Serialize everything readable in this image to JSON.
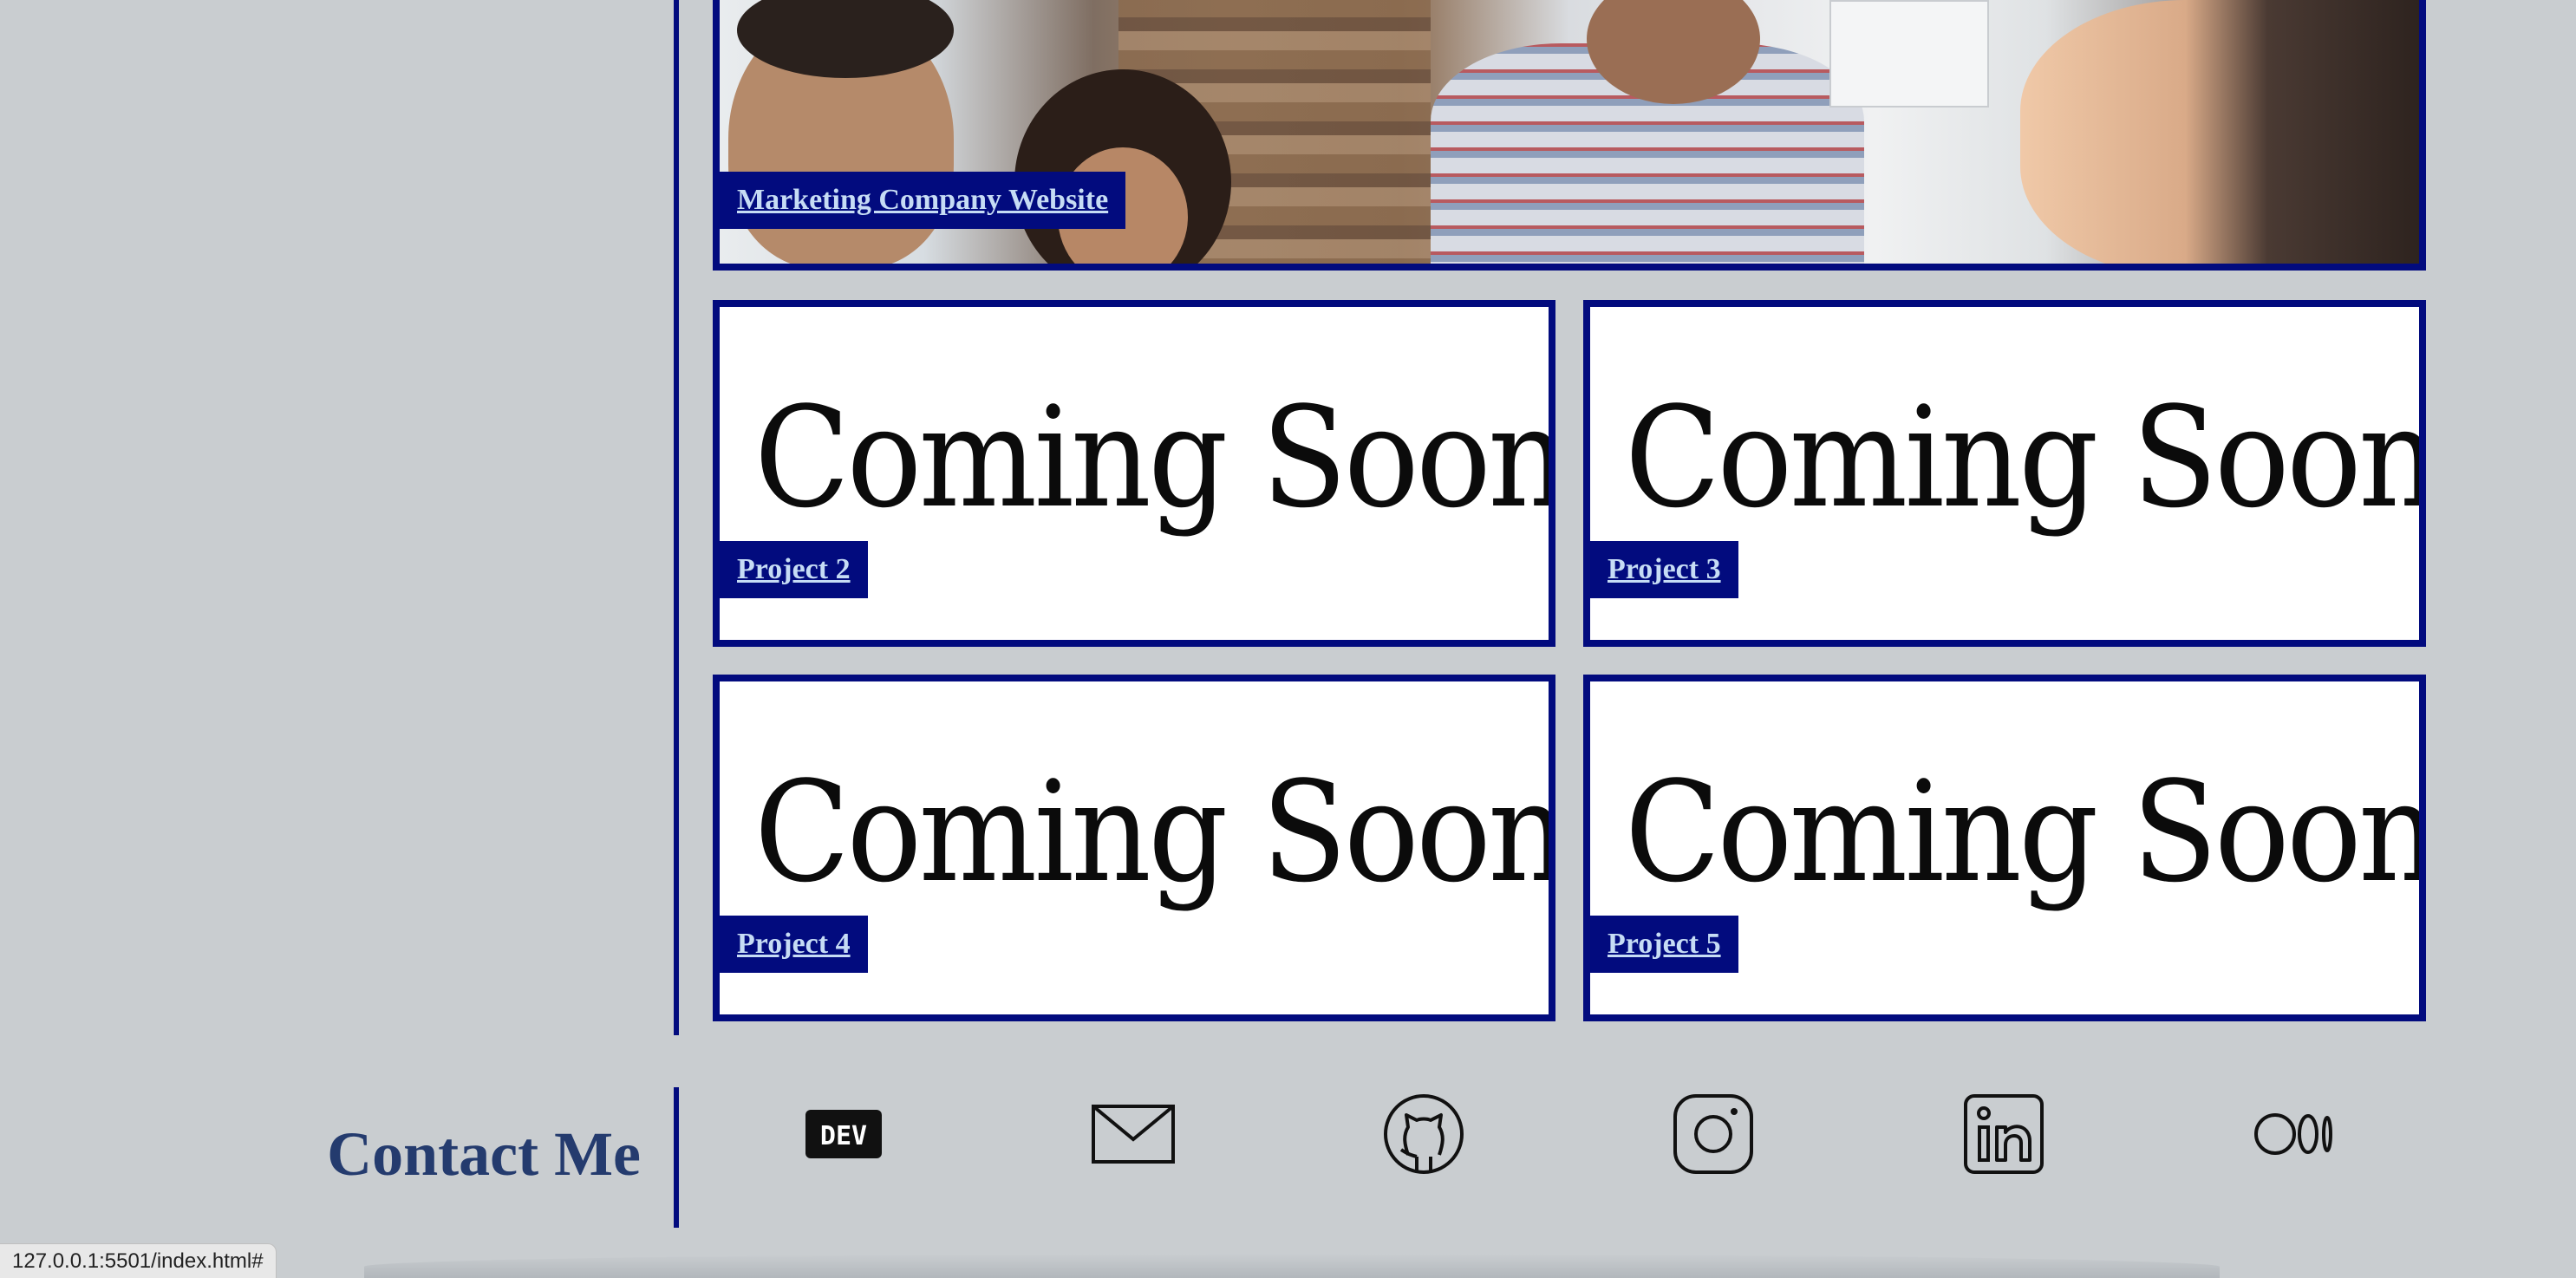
{
  "projects": {
    "featured": {
      "label": "Marketing Company Website"
    },
    "items": [
      {
        "label": "Project 2",
        "image_text": "Coming Soon"
      },
      {
        "label": "Project 3",
        "image_text": "Coming Soon"
      },
      {
        "label": "Project 4",
        "image_text": "Coming Soon"
      },
      {
        "label": "Project 5",
        "image_text": "Coming Soon"
      }
    ]
  },
  "contact": {
    "title": "Contact Me",
    "links": [
      {
        "icon": "dev-icon"
      },
      {
        "icon": "mail-icon"
      },
      {
        "icon": "github-icon"
      },
      {
        "icon": "instagram-icon"
      },
      {
        "icon": "linkedin-icon"
      },
      {
        "icon": "medium-icon"
      }
    ]
  },
  "status_bar": {
    "url": "127.0.0.1:5501/index.html#"
  },
  "colors": {
    "background": "#c9cdd0",
    "accent": "#020b7e",
    "link": "#c6dcf5",
    "heading": "#243b6e"
  }
}
